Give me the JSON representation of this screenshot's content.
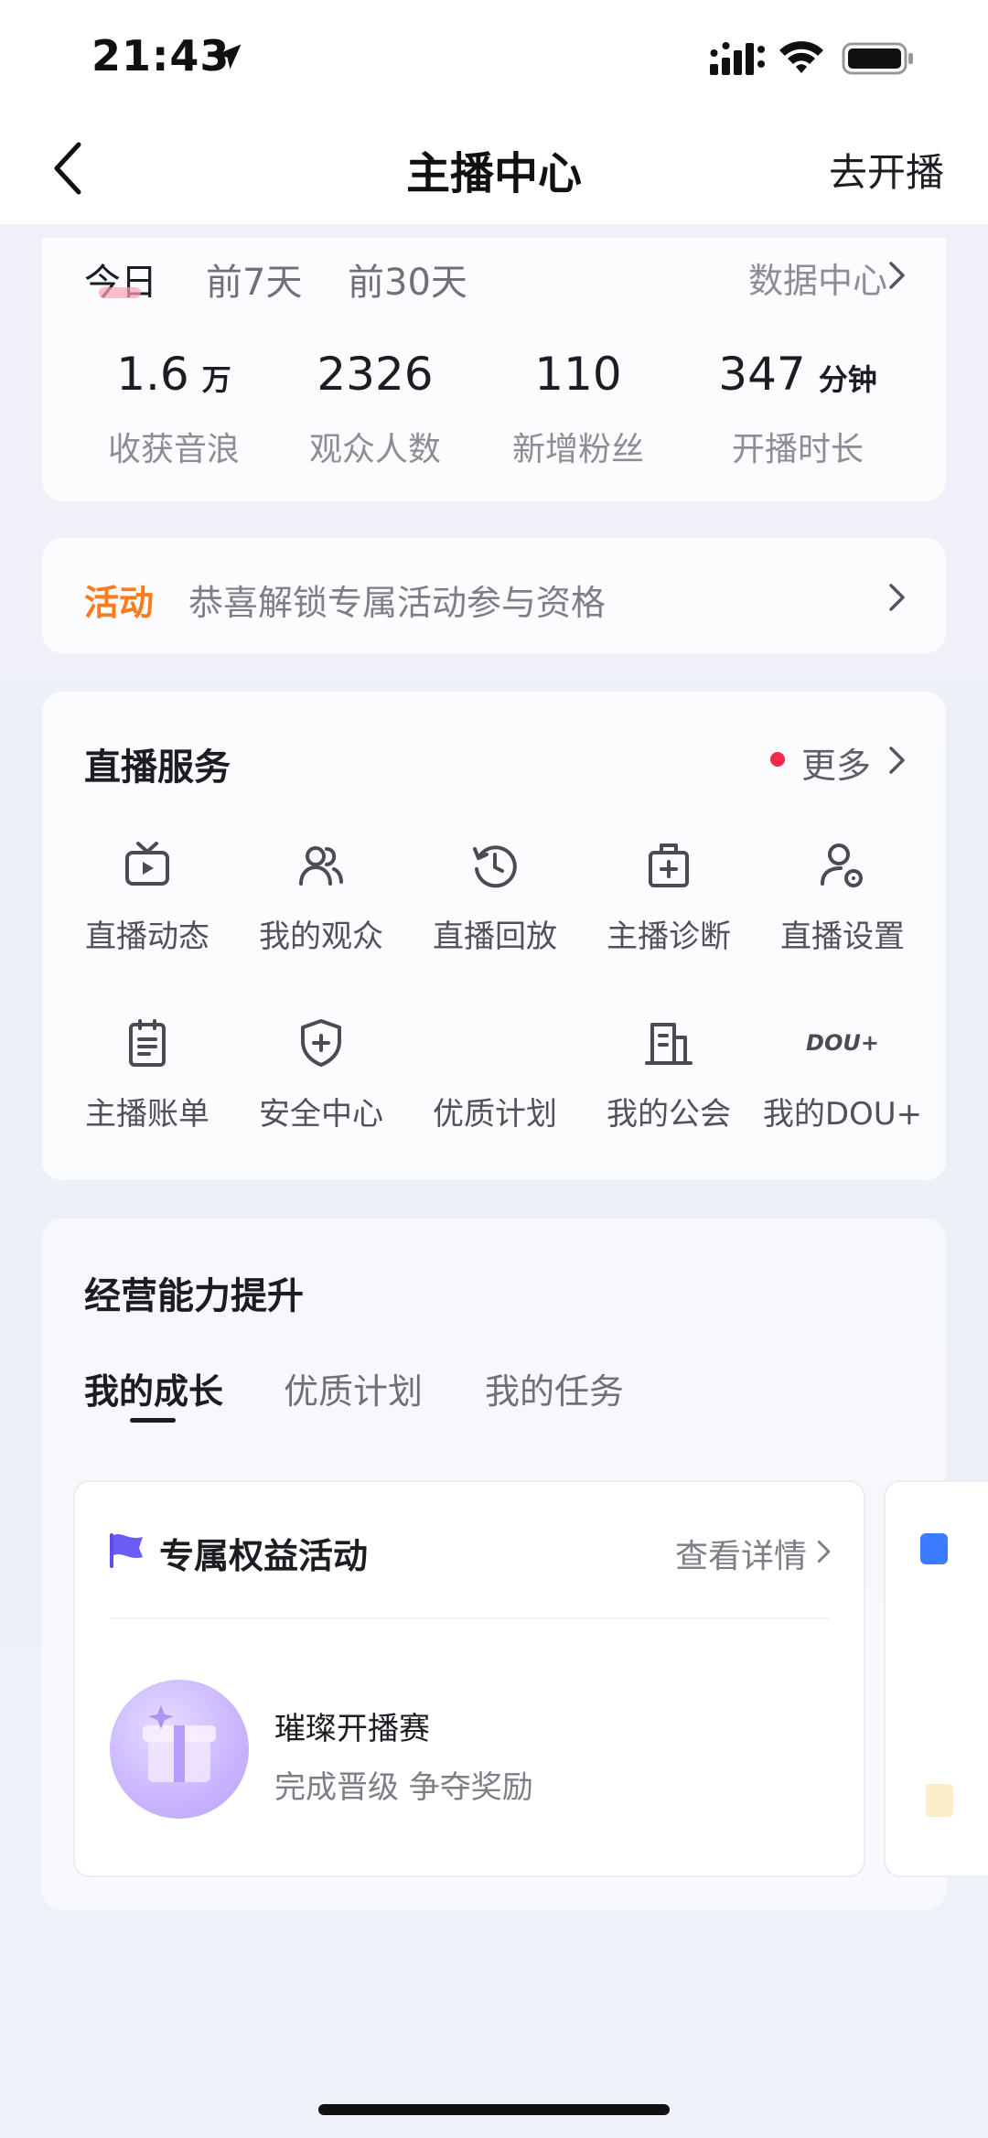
{
  "status_bar": {
    "time": "21:43"
  },
  "nav": {
    "title": "主播中心",
    "right_action": "去开播"
  },
  "stats": {
    "tabs": [
      "今日",
      "前7天",
      "前30天"
    ],
    "data_center": "数据中心",
    "items": [
      {
        "value": "1.6",
        "unit": "万",
        "label": "收获音浪"
      },
      {
        "value": "2326",
        "unit": "",
        "label": "观众人数"
      },
      {
        "value": "110",
        "unit": "",
        "label": "新增粉丝"
      },
      {
        "value": "347",
        "unit": "分钟",
        "label": "开播时长"
      }
    ]
  },
  "activity": {
    "tag": "活动",
    "text": "恭喜解锁专属活动参与资格"
  },
  "services": {
    "title": "直播服务",
    "more": "更多",
    "items": [
      {
        "label": "直播动态",
        "icon": "tv-play-icon"
      },
      {
        "label": "我的观众",
        "icon": "users-icon"
      },
      {
        "label": "直播回放",
        "icon": "history-icon"
      },
      {
        "label": "主播诊断",
        "icon": "medical-kit-icon"
      },
      {
        "label": "直播设置",
        "icon": "user-settings-icon"
      },
      {
        "label": "主播账单",
        "icon": "clipboard-icon"
      },
      {
        "label": "安全中心",
        "icon": "shield-plus-icon"
      },
      {
        "label": "优质计划",
        "icon": ""
      },
      {
        "label": "我的公会",
        "icon": "building-icon"
      },
      {
        "label": "我的DOU+",
        "icon": "dou-icon"
      }
    ],
    "dou_logo_text": "DOU+"
  },
  "growth": {
    "title": "经营能力提升",
    "tabs": [
      "我的成长",
      "优质计划",
      "我的任务"
    ],
    "card": {
      "title": "专属权益活动",
      "detail": "查看详情",
      "item_title": "璀璨开播赛",
      "item_sub": "完成晋级 争夺奖励"
    }
  },
  "colors": {
    "accent_orange": "#ff7a1a",
    "red_dot": "#f2294d",
    "flag_purple": "#5b4cf0"
  }
}
